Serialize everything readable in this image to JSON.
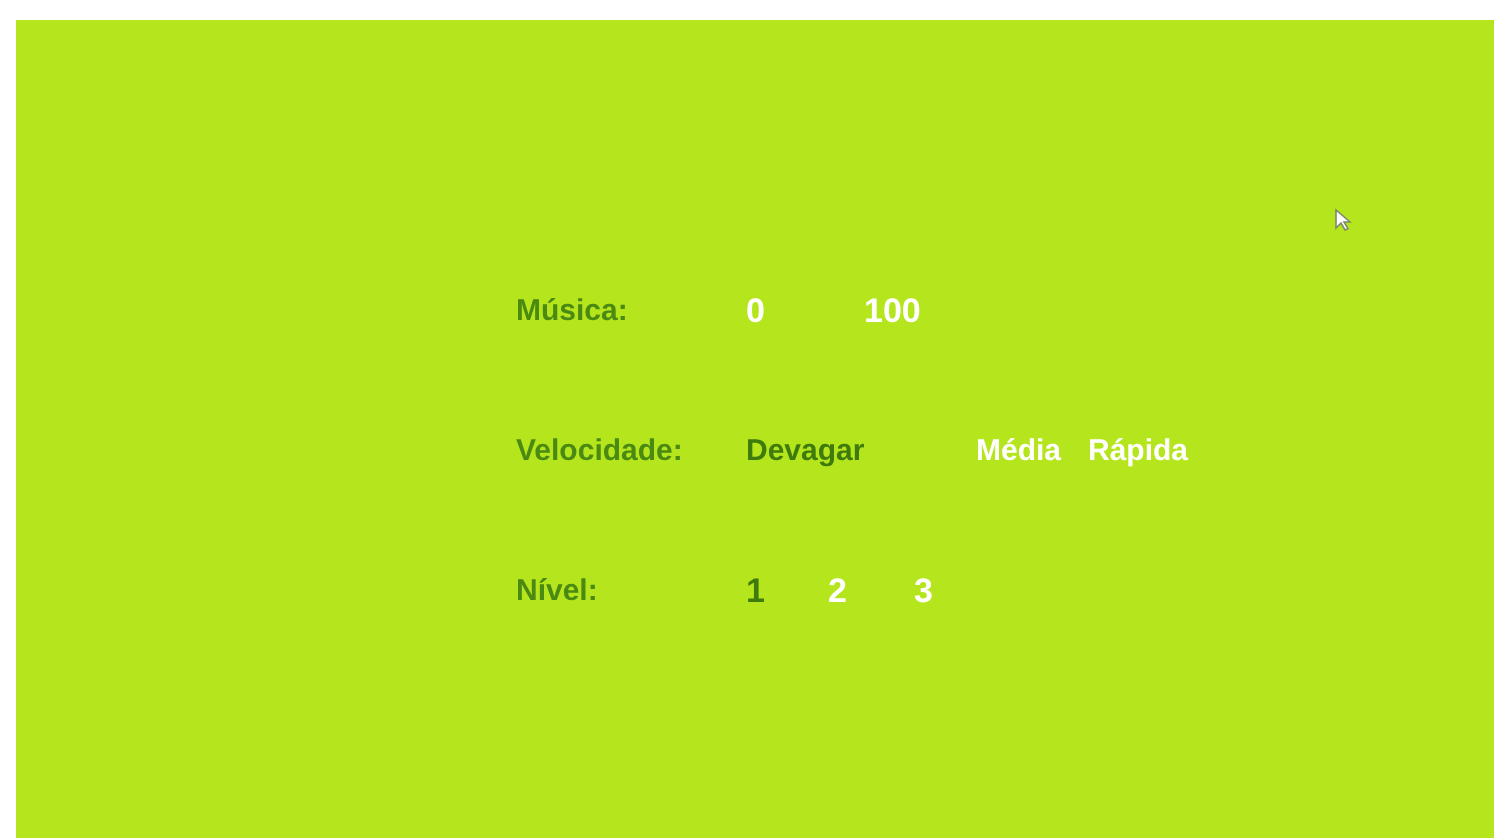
{
  "settings": [
    {
      "label": "Música:",
      "options": [
        {
          "text": "0",
          "selected": false
        },
        {
          "text": "100",
          "selected": false
        }
      ]
    },
    {
      "label": "Velocidade:",
      "options": [
        {
          "text": "Devagar",
          "selected": true
        },
        {
          "text": "Média",
          "selected": false
        },
        {
          "text": "Rápida",
          "selected": false
        }
      ]
    },
    {
      "label": "Nível:",
      "options": [
        {
          "text": "1",
          "selected": true
        },
        {
          "text": "2",
          "selected": false
        },
        {
          "text": "3",
          "selected": false
        }
      ]
    }
  ]
}
